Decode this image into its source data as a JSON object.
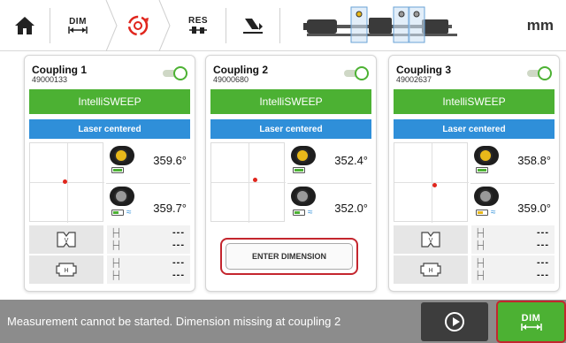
{
  "toolbar": {
    "home_icon": "home-icon",
    "dim_label": "DIM",
    "measure_icon": "measure-sweep-icon",
    "res_label": "RES",
    "report_icon": "report-icon",
    "units": "mm"
  },
  "colors": {
    "accent_green": "#4cb133",
    "laser_blue": "#2f8fd9",
    "alert_red": "#c4262e",
    "status_grey": "#8c8c8c"
  },
  "couplings": [
    {
      "title": "Coupling 1",
      "serial": "49000133",
      "sweep_label": "IntelliSWEEP",
      "laser_label": "Laser centered",
      "angle_top": "359.6°",
      "angle_bottom": "359.7°",
      "dims": [
        "---",
        "---",
        "---",
        "---"
      ]
    },
    {
      "title": "Coupling 2",
      "serial": "49000680",
      "sweep_label": "IntelliSWEEP",
      "laser_label": "Laser centered",
      "angle_top": "352.4°",
      "angle_bottom": "352.0°",
      "enter_dimension_label": "ENTER DIMENSION"
    },
    {
      "title": "Coupling 3",
      "serial": "49002637",
      "sweep_label": "IntelliSWEEP",
      "laser_label": "Laser centered",
      "angle_top": "358.8°",
      "angle_bottom": "359.0°",
      "dims": [
        "---",
        "---",
        "---",
        "---"
      ]
    }
  ],
  "statusbar": {
    "message": "Measurement cannot be started. Dimension missing at coupling 2",
    "dim_button_label": "DIM"
  }
}
